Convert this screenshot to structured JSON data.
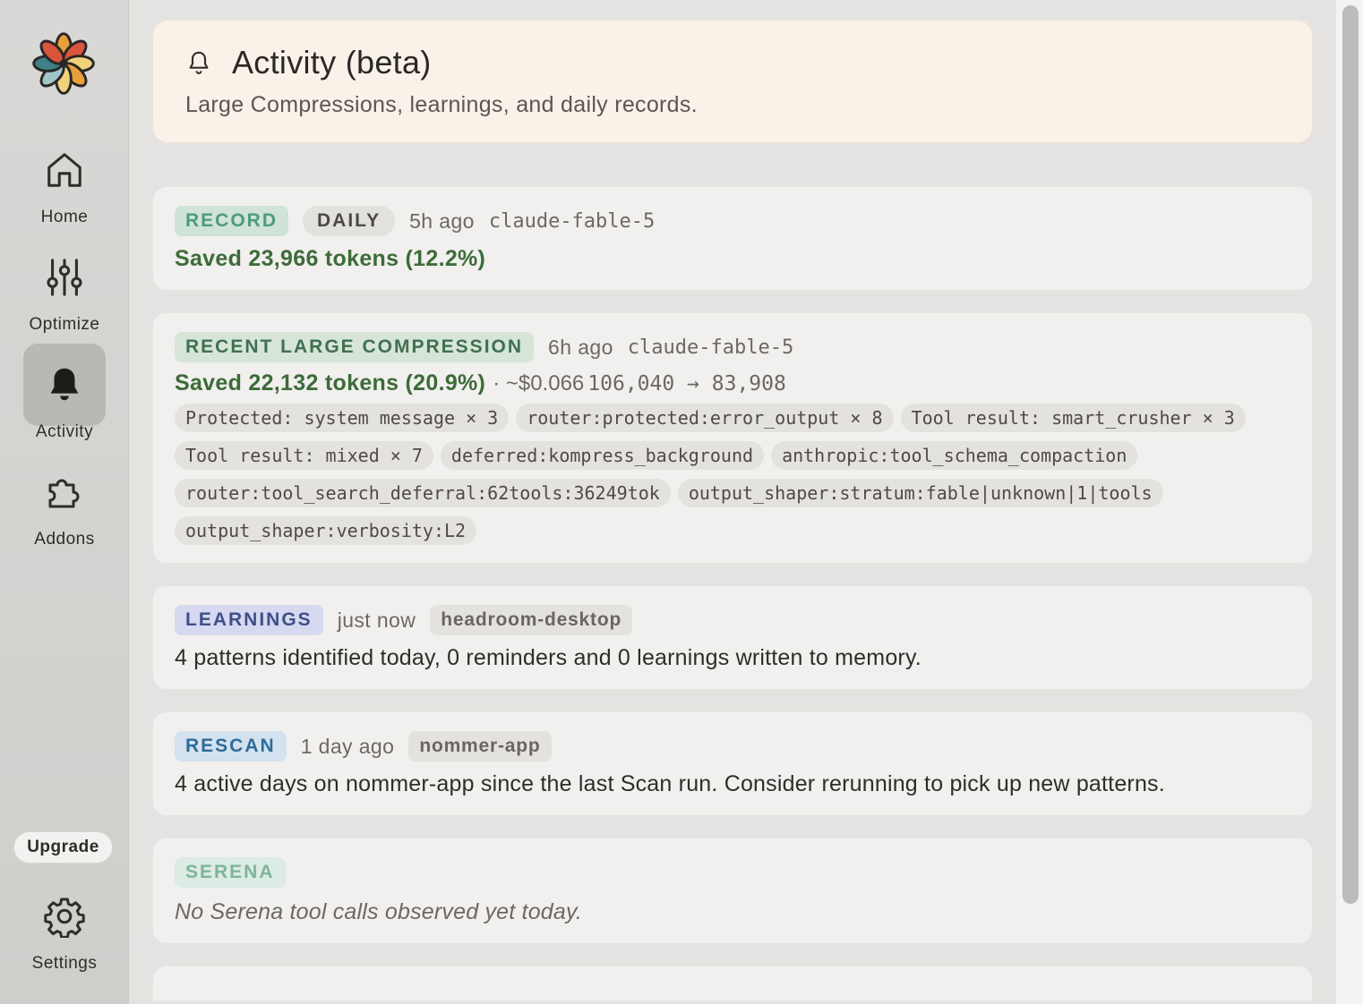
{
  "sidebar": {
    "items": [
      {
        "label": "Home",
        "icon": "home-icon"
      },
      {
        "label": "Optimize",
        "icon": "sliders-icon"
      },
      {
        "label": "Activity",
        "icon": "bell-icon",
        "active": true
      },
      {
        "label": "Addons",
        "icon": "puzzle-icon"
      }
    ],
    "upgrade_label": "Upgrade",
    "settings_label": "Settings"
  },
  "header": {
    "title": "Activity (beta)",
    "subtitle": "Large Compressions, learnings, and daily records."
  },
  "cards": {
    "record": {
      "tag": "RECORD",
      "period": "DAILY",
      "time": "5h ago",
      "model": "claude-fable-5",
      "saved": "Saved 23,966 tokens (12.2%)"
    },
    "compression": {
      "tag": "RECENT LARGE COMPRESSION",
      "time": "6h ago",
      "model": "claude-fable-5",
      "saved": "Saved 22,132 tokens (20.9%)",
      "cost": "· ~$0.066",
      "tokens_change": "106,040 → 83,908",
      "chips": [
        "Protected: system message × 3",
        "router:protected:error_output × 8",
        "Tool result: smart_crusher × 3",
        "Tool result: mixed × 7",
        "deferred:kompress_background",
        "anthropic:tool_schema_compaction",
        "router:tool_search_deferral:62tools:36249tok",
        "output_shaper:stratum:fable|unknown|1|tools",
        "output_shaper:verbosity:L2"
      ]
    },
    "learnings": {
      "tag": "LEARNINGS",
      "time": "just now",
      "project": "headroom-desktop",
      "text": "4 patterns identified today, 0 reminders and 0 learnings written to memory."
    },
    "rescan": {
      "tag": "RESCAN",
      "time": "1 day ago",
      "project": "nommer-app",
      "text": "4 active days on nommer-app since the last Scan run. Consider rerunning to pick up new patterns."
    },
    "serena": {
      "tag": "SERENA",
      "text": "No Serena tool calls observed yet today."
    }
  },
  "colors": {
    "accent_green": "#3d6b39",
    "header_bg": "#faf1e9",
    "card_bg": "#f1f0ee"
  }
}
